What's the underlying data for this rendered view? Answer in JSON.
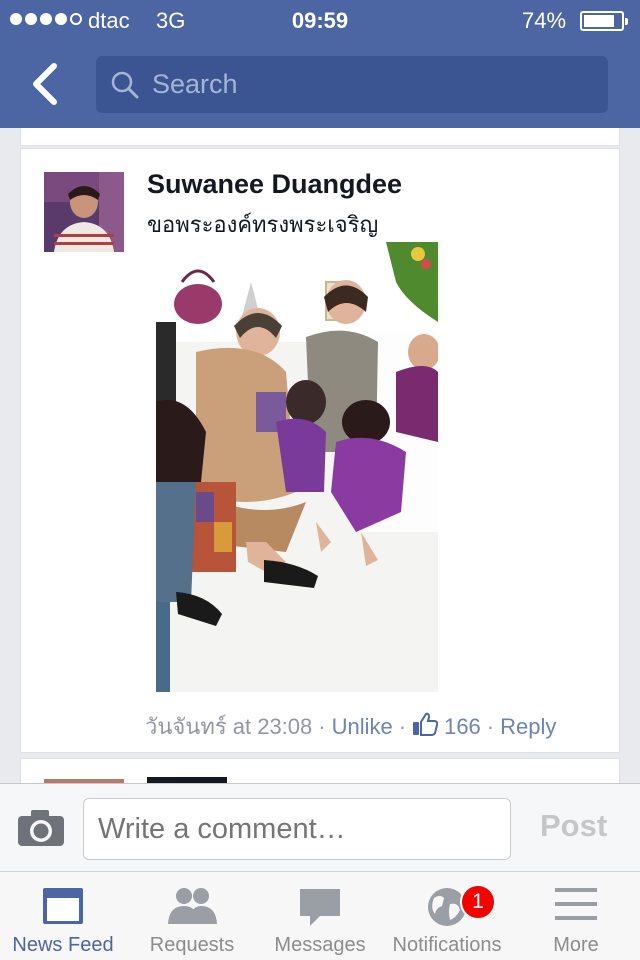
{
  "status_bar": {
    "carrier": "dtac",
    "network": "3G",
    "time": "09:59",
    "battery": "74%"
  },
  "nav": {
    "back_icon": "chevron-left-icon",
    "search_placeholder": "Search"
  },
  "post": {
    "author": "Suwanee Duangdee",
    "text": "ขอพระองค์ทรงพระเจริญ",
    "timestamp": "วันจันทร์ at 23:08",
    "unlike_label": "Unlike",
    "like_count": "166",
    "reply_label": "Reply",
    "separator": "·"
  },
  "composer": {
    "placeholder": "Write a comment…",
    "post_label": "Post"
  },
  "tabs": [
    {
      "label": "News Feed",
      "icon": "news-feed-icon",
      "active": true
    },
    {
      "label": "Requests",
      "icon": "friend-requests-icon",
      "active": false
    },
    {
      "label": "Messages",
      "icon": "messages-icon",
      "active": false
    },
    {
      "label": "Notifications",
      "icon": "globe-icon",
      "active": false,
      "badge": "1"
    },
    {
      "label": "More",
      "icon": "menu-icon",
      "active": false
    }
  ],
  "colors": {
    "brand": "#4c66a4",
    "link": "#6d84b4",
    "badge": "#f70000"
  }
}
